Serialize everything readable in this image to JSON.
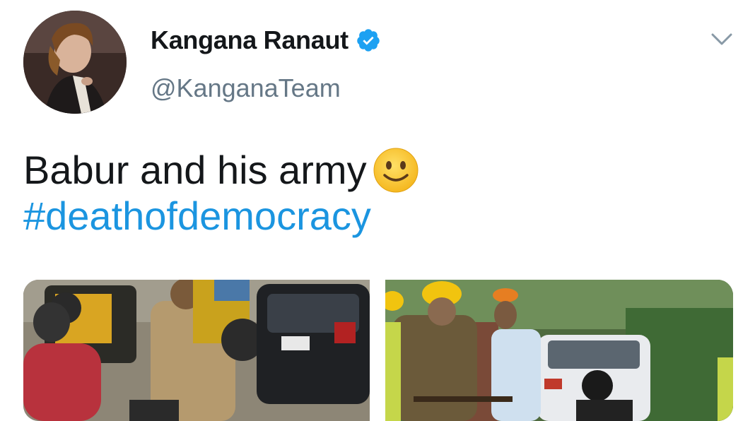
{
  "tweet": {
    "author": {
      "display_name": "Kangana Ranaut",
      "handle": "@KanganaTeam",
      "verified": true,
      "verified_icon": "verified-badge-icon",
      "avatar_icon": "profile-photo"
    },
    "text": "Babur and his army",
    "emoji": "slightly-smiling-face-emoji",
    "hashtag": "#deathofdemocracy",
    "menu_icon": "chevron-down-icon",
    "media": [
      {
        "label": "photo-police-and-car"
      },
      {
        "label": "photo-workers-and-car"
      }
    ]
  },
  "colors": {
    "text_primary": "#14171a",
    "text_secondary": "#657786",
    "link": "#1b95e0",
    "verified": "#1da1f2"
  }
}
